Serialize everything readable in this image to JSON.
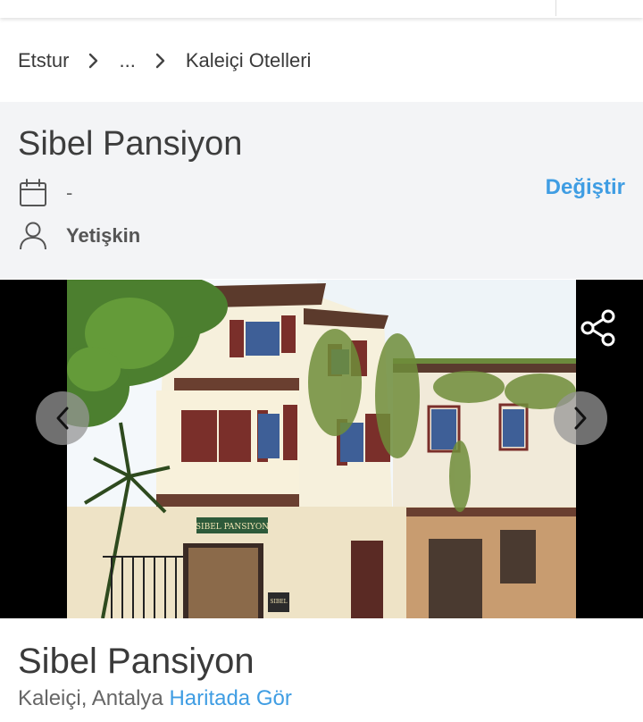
{
  "breadcrumb": {
    "items": [
      "Etstur",
      "...",
      "Kaleiçi Otelleri"
    ]
  },
  "booking": {
    "title": "Sibel Pansiyon",
    "date_value": "-",
    "guest_value": "Yetişkin",
    "change_label": "Değiştir"
  },
  "gallery": {
    "sign_text": "SIBEL PANSIYON",
    "plaque_text": "SIBEL"
  },
  "hotel": {
    "name": "Sibel Pansiyon",
    "location": "Kaleiçi, Antalya",
    "map_link": "Haritada Gör"
  },
  "colors": {
    "accent": "#3f9de3",
    "booking_bg": "#f3f4f6",
    "text": "#3a3a3a"
  },
  "icons": {
    "date": "calendar-icon",
    "guest": "user-icon",
    "share": "share-icon",
    "prev": "chevron-left-icon",
    "next": "chevron-right-icon",
    "breadcrumb_separator": "chevron-right-icon"
  }
}
